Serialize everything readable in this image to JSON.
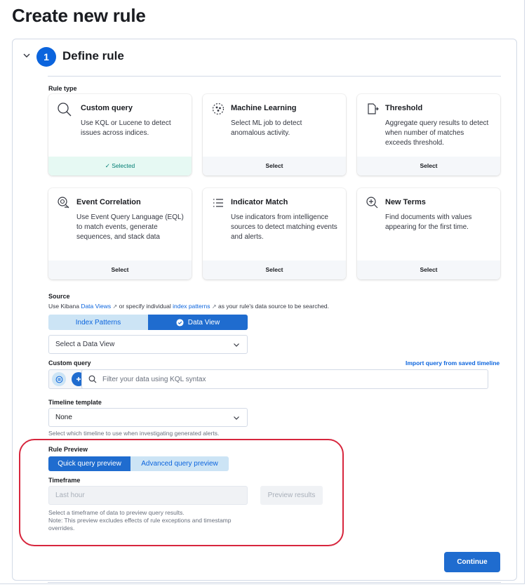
{
  "page": {
    "title": "Create new rule"
  },
  "step": {
    "number": "1",
    "title": "Define rule"
  },
  "rule_type": {
    "label": "Rule type",
    "cards": [
      {
        "title": "Custom query",
        "desc": "Use KQL or Lucene to detect issues across indices.",
        "action": "Selected",
        "icon": "search-icon"
      },
      {
        "title": "Machine Learning",
        "desc": "Select ML job to detect anomalous activity.",
        "action": "Select",
        "icon": "ml-icon"
      },
      {
        "title": "Threshold",
        "desc": "Aggregate query results to detect when number of matches exceeds threshold.",
        "action": "Select",
        "icon": "threshold-icon"
      },
      {
        "title": "Event Correlation",
        "desc": "Use Event Query Language (EQL) to match events, generate sequences, and stack data",
        "action": "Select",
        "icon": "eql-icon"
      },
      {
        "title": "Indicator Match",
        "desc": "Use indicators from intelligence sources to detect matching events and alerts.",
        "action": "Select",
        "icon": "list-icon"
      },
      {
        "title": "New Terms",
        "desc": "Find documents with values appearing for the first time.",
        "action": "Select",
        "icon": "zoom-plus-icon"
      }
    ],
    "selected_mark": "✓"
  },
  "source": {
    "label": "Source",
    "help_prefix": "Use Kibana ",
    "data_views_link": "Data Views",
    "help_middle": " or specify individual ",
    "index_patterns_link": "index patterns",
    "help_suffix": " as your rule's data source to be searched.",
    "tabs": [
      "Index Patterns",
      "Data View"
    ],
    "active_tab": "Data View",
    "select_placeholder": "Select a Data View"
  },
  "custom_query": {
    "label": "Custom query",
    "import_link": "Import query from saved timeline",
    "placeholder": "Filter your data using KQL syntax"
  },
  "timeline_template": {
    "label": "Timeline template",
    "value": "None",
    "help": "Select which timeline to use when investigating generated alerts."
  },
  "rule_preview": {
    "label": "Rule Preview",
    "tabs": [
      "Quick query preview",
      "Advanced query preview"
    ],
    "active_tab": "Quick query preview",
    "timeframe_label": "Timeframe",
    "timeframe_value": "Last hour",
    "preview_button": "Preview results",
    "help_line1": "Select a timeframe of data to preview query results.",
    "help_line2": "Note: This preview excludes effects of rule exceptions and timestamp overrides."
  },
  "footer": {
    "continue_label": "Continue"
  },
  "colors": {
    "primary": "#1f6ccf",
    "accent": "#0b64dd",
    "selected_bg": "#e6f9f3",
    "highlight": "#d7263d"
  }
}
